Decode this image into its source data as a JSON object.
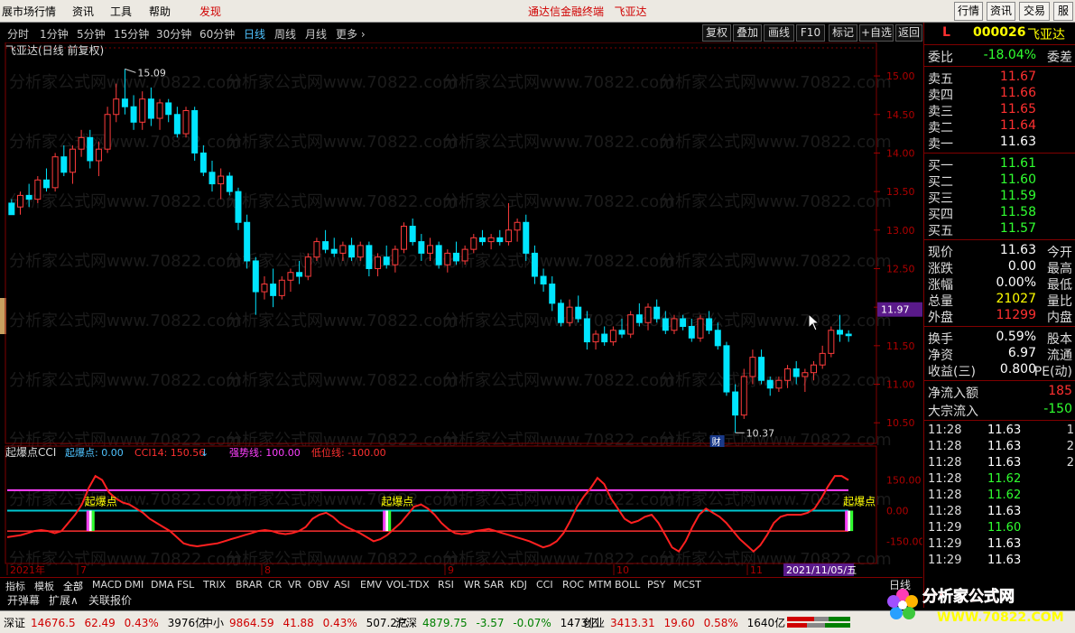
{
  "menubar": {
    "items": [
      "展市场行情",
      "资讯",
      "工具",
      "帮助",
      "发现"
    ],
    "title": "通达信金融终端",
    "stock": "飞亚达",
    "buttons": [
      "行情",
      "资讯",
      "交易",
      "服"
    ]
  },
  "periodbar": {
    "periods": [
      "分时",
      "1分钟",
      "5分钟",
      "15分钟",
      "30分钟",
      "60分钟",
      "日线",
      "周线",
      "月线",
      "更多 ›"
    ],
    "active_index": 6,
    "right_buttons": [
      "复权",
      "叠加",
      "画线",
      "F10",
      "标记",
      "+自选",
      "返回"
    ]
  },
  "chart_header": "飞亚达(日线 前复权)",
  "watermark": "分析家公式网www.70822.com",
  "chart_data": [
    {
      "type": "candlestick",
      "ylim": [
        10.35,
        15.2
      ],
      "yticks": [
        "15.00",
        "14.50",
        "14.00",
        "13.50",
        "13.00",
        "12.50",
        "12.00",
        "11.50",
        "11.00",
        "10.50"
      ],
      "current_price": "11.97",
      "high_marker": "15.09",
      "low_marker": "10.37",
      "finance_marker": "财",
      "x_labels": [
        "2021年",
        "7",
        "8",
        "9",
        "10",
        "11"
      ],
      "date_label": "2021/11/05/五",
      "candles": [
        [
          13.35,
          13.4,
          13.25,
          13.2
        ],
        [
          13.3,
          13.5,
          13.2,
          13.45
        ],
        [
          13.45,
          13.6,
          13.3,
          13.4
        ],
        [
          13.4,
          13.7,
          13.35,
          13.65
        ],
        [
          13.65,
          13.8,
          13.5,
          13.55
        ],
        [
          13.55,
          14.0,
          13.5,
          13.95
        ],
        [
          13.95,
          14.1,
          13.7,
          13.75
        ],
        [
          13.75,
          14.1,
          13.6,
          14.05
        ],
        [
          14.05,
          14.3,
          13.95,
          14.2
        ],
        [
          14.2,
          14.3,
          13.8,
          13.9
        ],
        [
          13.9,
          14.15,
          13.7,
          14.05
        ],
        [
          14.05,
          14.6,
          14.0,
          14.5
        ],
        [
          14.5,
          14.9,
          14.4,
          14.7
        ],
        [
          14.7,
          15.09,
          14.5,
          14.6
        ],
        [
          14.6,
          14.75,
          14.3,
          14.4
        ],
        [
          14.4,
          14.8,
          14.3,
          14.7
        ],
        [
          14.7,
          14.85,
          14.35,
          14.45
        ],
        [
          14.45,
          14.7,
          14.3,
          14.65
        ],
        [
          14.65,
          14.7,
          14.4,
          14.5
        ],
        [
          14.5,
          14.6,
          14.2,
          14.25
        ],
        [
          14.25,
          14.6,
          14.2,
          14.55
        ],
        [
          14.55,
          14.6,
          13.9,
          14.0
        ],
        [
          14.0,
          14.1,
          13.7,
          13.75
        ],
        [
          13.75,
          13.9,
          13.5,
          13.6
        ],
        [
          13.6,
          13.8,
          13.4,
          13.7
        ],
        [
          13.7,
          13.75,
          13.45,
          13.5
        ],
        [
          13.5,
          13.55,
          13.0,
          13.1
        ],
        [
          13.1,
          13.2,
          12.5,
          12.6
        ],
        [
          12.6,
          12.65,
          11.9,
          12.2
        ],
        [
          12.2,
          12.4,
          12.1,
          12.3
        ],
        [
          12.3,
          12.5,
          12.0,
          12.15
        ],
        [
          12.15,
          12.4,
          12.1,
          12.35
        ],
        [
          12.35,
          12.5,
          12.2,
          12.45
        ],
        [
          12.45,
          12.6,
          12.3,
          12.4
        ],
        [
          12.4,
          12.7,
          12.35,
          12.65
        ],
        [
          12.65,
          12.9,
          12.6,
          12.85
        ],
        [
          12.85,
          13.0,
          12.7,
          12.75
        ],
        [
          12.75,
          12.9,
          12.65,
          12.7
        ],
        [
          12.7,
          12.85,
          12.6,
          12.8
        ],
        [
          12.8,
          12.9,
          12.6,
          12.65
        ],
        [
          12.65,
          12.85,
          12.6,
          12.8
        ],
        [
          12.8,
          12.85,
          12.4,
          12.5
        ],
        [
          12.5,
          12.7,
          12.4,
          12.65
        ],
        [
          12.65,
          12.8,
          12.5,
          12.55
        ],
        [
          12.55,
          12.8,
          12.45,
          12.75
        ],
        [
          12.75,
          13.1,
          12.7,
          13.05
        ],
        [
          13.05,
          13.15,
          12.8,
          12.85
        ],
        [
          12.85,
          12.95,
          12.6,
          12.7
        ],
        [
          12.7,
          12.9,
          12.6,
          12.8
        ],
        [
          12.8,
          12.85,
          12.5,
          12.55
        ],
        [
          12.55,
          12.75,
          12.45,
          12.7
        ],
        [
          12.7,
          12.85,
          12.55,
          12.6
        ],
        [
          12.6,
          12.8,
          12.55,
          12.75
        ],
        [
          12.75,
          12.95,
          12.7,
          12.9
        ],
        [
          12.9,
          13.0,
          12.8,
          12.85
        ],
        [
          12.85,
          12.95,
          12.75,
          12.9
        ],
        [
          12.9,
          13.0,
          12.8,
          12.85
        ],
        [
          12.85,
          13.35,
          12.8,
          13.0
        ],
        [
          13.0,
          13.15,
          12.85,
          13.1
        ],
        [
          13.1,
          13.2,
          12.6,
          12.7
        ],
        [
          12.7,
          12.8,
          12.3,
          12.4
        ],
        [
          12.4,
          12.5,
          12.2,
          12.3
        ],
        [
          12.3,
          12.4,
          11.95,
          12.05
        ],
        [
          12.05,
          12.1,
          11.75,
          11.8
        ],
        [
          11.8,
          12.1,
          11.75,
          12.0
        ],
        [
          12.0,
          12.15,
          11.8,
          11.85
        ],
        [
          11.85,
          11.95,
          11.45,
          11.55
        ],
        [
          11.55,
          11.7,
          11.45,
          11.65
        ],
        [
          11.65,
          11.75,
          11.5,
          11.55
        ],
        [
          11.55,
          11.75,
          11.5,
          11.7
        ],
        [
          11.7,
          11.85,
          11.6,
          11.65
        ],
        [
          11.65,
          11.95,
          11.6,
          11.9
        ],
        [
          11.9,
          12.05,
          11.75,
          11.8
        ],
        [
          11.8,
          12.05,
          11.7,
          12.0
        ],
        [
          12.0,
          12.1,
          11.8,
          11.85
        ],
        [
          11.85,
          11.95,
          11.65,
          11.7
        ],
        [
          11.7,
          11.9,
          11.65,
          11.85
        ],
        [
          11.85,
          11.9,
          11.7,
          11.75
        ],
        [
          11.75,
          11.85,
          11.55,
          11.6
        ],
        [
          11.6,
          11.9,
          11.55,
          11.85
        ],
        [
          11.85,
          11.95,
          11.65,
          11.7
        ],
        [
          11.7,
          11.8,
          11.45,
          11.5
        ],
        [
          11.5,
          11.55,
          10.85,
          10.9
        ],
        [
          10.9,
          11.0,
          10.37,
          10.6
        ],
        [
          10.6,
          11.2,
          10.55,
          11.1
        ],
        [
          11.1,
          11.45,
          11.0,
          11.35
        ],
        [
          11.35,
          11.45,
          11.0,
          11.05
        ],
        [
          11.05,
          11.1,
          10.85,
          10.95
        ],
        [
          10.95,
          11.1,
          10.9,
          11.05
        ],
        [
          11.05,
          11.25,
          10.95,
          11.2
        ],
        [
          11.2,
          11.3,
          11.0,
          11.1
        ],
        [
          11.1,
          11.2,
          10.9,
          11.15
        ],
        [
          11.15,
          11.3,
          11.05,
          11.25
        ],
        [
          11.25,
          11.5,
          11.2,
          11.4
        ],
        [
          11.4,
          11.75,
          11.35,
          11.7
        ],
        [
          11.7,
          11.9,
          11.55,
          11.65
        ],
        [
          11.65,
          11.7,
          11.55,
          11.63
        ]
      ]
    },
    {
      "type": "line",
      "title": "起爆点CCI",
      "legend": [
        {
          "name": "起爆点",
          "value": "0.00",
          "color": "#4fc3ff"
        },
        {
          "name": "CCI14",
          "value": "150.56",
          "color": "#ff3030"
        },
        {
          "name": "强势线",
          "value": "100.00",
          "color": "#ff40ff"
        },
        {
          "name": "低位线",
          "value": "-100.00",
          "color": "#ff3030"
        }
      ],
      "ylim": [
        -250,
        250
      ],
      "yticks": [
        "150.00",
        "0.00",
        "-150.00"
      ],
      "lines": {
        "strong": 100,
        "zero": 0,
        "low": -100
      },
      "signal_label": "起爆点",
      "signals": [
        9,
        43,
        96
      ],
      "cci": [
        -130,
        -125,
        -120,
        -110,
        -100,
        -95,
        -100,
        -110,
        -100,
        -60,
        -20,
        30,
        110,
        170,
        150,
        90,
        60,
        40,
        30,
        10,
        -10,
        -40,
        -60,
        -80,
        -100,
        -130,
        -160,
        -170,
        -175,
        -170,
        -165,
        -160,
        -150,
        -140,
        -130,
        -120,
        -110,
        -100,
        -95,
        -100,
        -110,
        -115,
        -110,
        -100,
        -80,
        -40,
        -20,
        -10,
        -30,
        -60,
        -80,
        -95,
        -110,
        -130,
        -150,
        -140,
        -120,
        -90,
        -60,
        -20,
        20,
        30,
        10,
        -20,
        -60,
        -90,
        -110,
        -115,
        -110,
        -100,
        -95,
        -90,
        -100,
        -110,
        -120,
        -130,
        -140,
        -150,
        -165,
        -180,
        -170,
        -150,
        -110,
        -50,
        20,
        70,
        110,
        160,
        130,
        60,
        10,
        -40,
        -60,
        -50,
        -30,
        -20,
        -60,
        -120,
        -180,
        -200,
        -150,
        -80,
        -20,
        10,
        -10,
        -30,
        -60,
        -100,
        -140,
        -170,
        -200,
        -170,
        -120,
        -60,
        -30,
        -20,
        -20,
        -20,
        -10,
        10,
        60,
        120,
        170,
        170,
        150
      ]
    }
  ],
  "indicator_tabs": [
    "指标",
    "模板",
    "全部",
    "MACD",
    "DMI",
    "DMA",
    "FSL",
    "TRIX",
    "BRAR",
    "CR",
    "VR",
    "OBV",
    "ASI",
    "EMV",
    "VOL-TDX",
    "RSI",
    "WR",
    "SAR",
    "KDJ",
    "CCI",
    "ROC",
    "MTM",
    "BOLL",
    "PSY",
    "MCST"
  ],
  "indicator_tabs_active": 2,
  "option_tabs": [
    "开弹幕",
    "扩展∧",
    "关联报价"
  ],
  "period_label_right": "日线",
  "quote": {
    "code": "000026",
    "name": "飞亚达",
    "flag": "L",
    "webi": {
      "label": "委比",
      "value": "-18.04%",
      "label2": "委差"
    },
    "asks": [
      {
        "label": "卖五",
        "price": "11.67"
      },
      {
        "label": "卖四",
        "price": "11.66"
      },
      {
        "label": "卖三",
        "price": "11.65"
      },
      {
        "label": "卖二",
        "price": "11.64"
      },
      {
        "label": "卖一",
        "price": "11.63"
      }
    ],
    "bids": [
      {
        "label": "买一",
        "price": "11.61"
      },
      {
        "label": "买二",
        "price": "11.60"
      },
      {
        "label": "买三",
        "price": "11.59"
      },
      {
        "label": "买四",
        "price": "11.58"
      },
      {
        "label": "买五",
        "price": "11.57"
      }
    ],
    "stats": [
      {
        "label": "现价",
        "value": "11.63",
        "label2": "今开",
        "color": "#ffffff"
      },
      {
        "label": "涨跌",
        "value": "0.00",
        "label2": "最高",
        "color": "#ffffff"
      },
      {
        "label": "涨幅",
        "value": "0.00%",
        "label2": "最低",
        "color": "#ffffff"
      },
      {
        "label": "总量",
        "value": "21027",
        "label2": "量比",
        "color": "#ffff00"
      },
      {
        "label": "外盘",
        "value": "11299",
        "label2": "内盘",
        "color": "#ff3030"
      }
    ],
    "stats2": [
      {
        "label": "换手",
        "value": "0.59%",
        "label2": "股本"
      },
      {
        "label": "净资",
        "value": "6.97",
        "label2": "流通"
      },
      {
        "label": "收益(三)",
        "value": "0.800",
        "label2": "PE(动)"
      }
    ],
    "flows": [
      {
        "label": "净流入额",
        "value": "185",
        "color": "#ff3030"
      },
      {
        "label": "大宗流入",
        "value": "-150",
        "color": "#30ff30"
      }
    ],
    "ticks": [
      {
        "time": "11:28",
        "price": "11.63",
        "vol": "1",
        "color": "#ffffff"
      },
      {
        "time": "11:28",
        "price": "11.63",
        "vol": "2",
        "color": "#ffffff"
      },
      {
        "time": "11:28",
        "price": "11.63",
        "vol": "2",
        "color": "#ffffff"
      },
      {
        "time": "11:28",
        "price": "11.62",
        "vol": "",
        "color": "#30ff30"
      },
      {
        "time": "11:28",
        "price": "11.62",
        "vol": "",
        "color": "#30ff30"
      },
      {
        "time": "11:28",
        "price": "11.63",
        "vol": "",
        "color": "#ffffff"
      },
      {
        "time": "11:29",
        "price": "11.60",
        "vol": "",
        "color": "#30ff30"
      },
      {
        "time": "11:29",
        "price": "11.63",
        "vol": "",
        "color": "#ffffff"
      },
      {
        "time": "11:29",
        "price": "11.63",
        "vol": "",
        "color": "#ffffff"
      }
    ]
  },
  "statusbar": {
    "items": [
      {
        "label": "深证",
        "value": "14676.5",
        "chg": "62.49",
        "pct": "0.43%",
        "amt": "3976亿"
      },
      {
        "label": "中小",
        "value": "9864.59",
        "chg": "41.88",
        "pct": "0.43%",
        "amt": "507.2亿"
      },
      {
        "label": "沪深",
        "value": "4879.75",
        "chg": "-3.57",
        "pct": "-0.07%",
        "amt": "1473亿"
      },
      {
        "label": "创业",
        "value": "3413.31",
        "chg": "19.60",
        "pct": "0.58%",
        "amt": "1640亿"
      }
    ]
  },
  "logo": {
    "text": "分析家公式网",
    "url": "WWW.70822.COM"
  }
}
